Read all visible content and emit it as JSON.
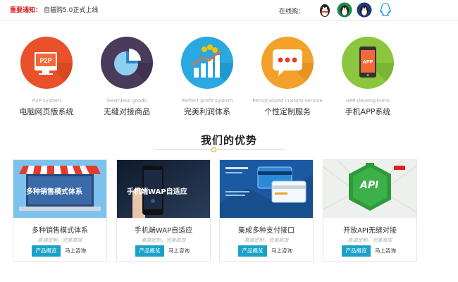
{
  "topbar": {
    "notice_label": "重要通知：",
    "notice_text": "自猫购5.0正式上线",
    "consult_label": "在线购：",
    "qq_icons": [
      "qq-penguin-icon",
      "qq-penguin-green-icon",
      "qq-penguin-blue-icon",
      "qq-outline-icon"
    ]
  },
  "features": [
    {
      "en": "P2P system",
      "zh": "电脑网页版系统",
      "icon": "p2p-icon",
      "color": "#e8512a",
      "icon_text": "P2P"
    },
    {
      "en": "Seamless goods",
      "zh": "无缝对接商品",
      "icon": "pie-chart-icon",
      "color": "#4a3a5c"
    },
    {
      "en": "Perfect profit system",
      "zh": "完美利润体系",
      "icon": "bar-chart-icon",
      "color": "#2aa8e0"
    },
    {
      "en": "Personalized custom service",
      "zh": "个性定制服务",
      "icon": "chat-bubble-icon",
      "color": "#f2a12a"
    },
    {
      "en": "APP development",
      "zh": "手机APP系统",
      "icon": "mobile-app-icon",
      "color": "#8cc63e",
      "icon_text": "APP"
    }
  ],
  "section": {
    "title": "我们的优势"
  },
  "cards": [
    {
      "banner_text": "多种销售模式体系",
      "title": "多种销售模式体系",
      "subtitle": "高端定制，完美高效",
      "btn_primary": "产品概览",
      "btn_link": "马上咨询"
    },
    {
      "banner_text": "手机端WAP自适应",
      "title": "手机端WAP自适应",
      "subtitle": "高端定制，完美高效",
      "btn_primary": "产品概览",
      "btn_link": "马上咨询"
    },
    {
      "banner_text": "",
      "title": "集成多种支付接口",
      "subtitle": "高端定制，完美高效",
      "btn_primary": "产品概览",
      "btn_link": "马上咨询"
    },
    {
      "banner_text": "API",
      "title": "开放API无缝对接",
      "subtitle": "高端定制，完美高效",
      "btn_primary": "产品概览",
      "btn_link": "马上咨询"
    }
  ]
}
